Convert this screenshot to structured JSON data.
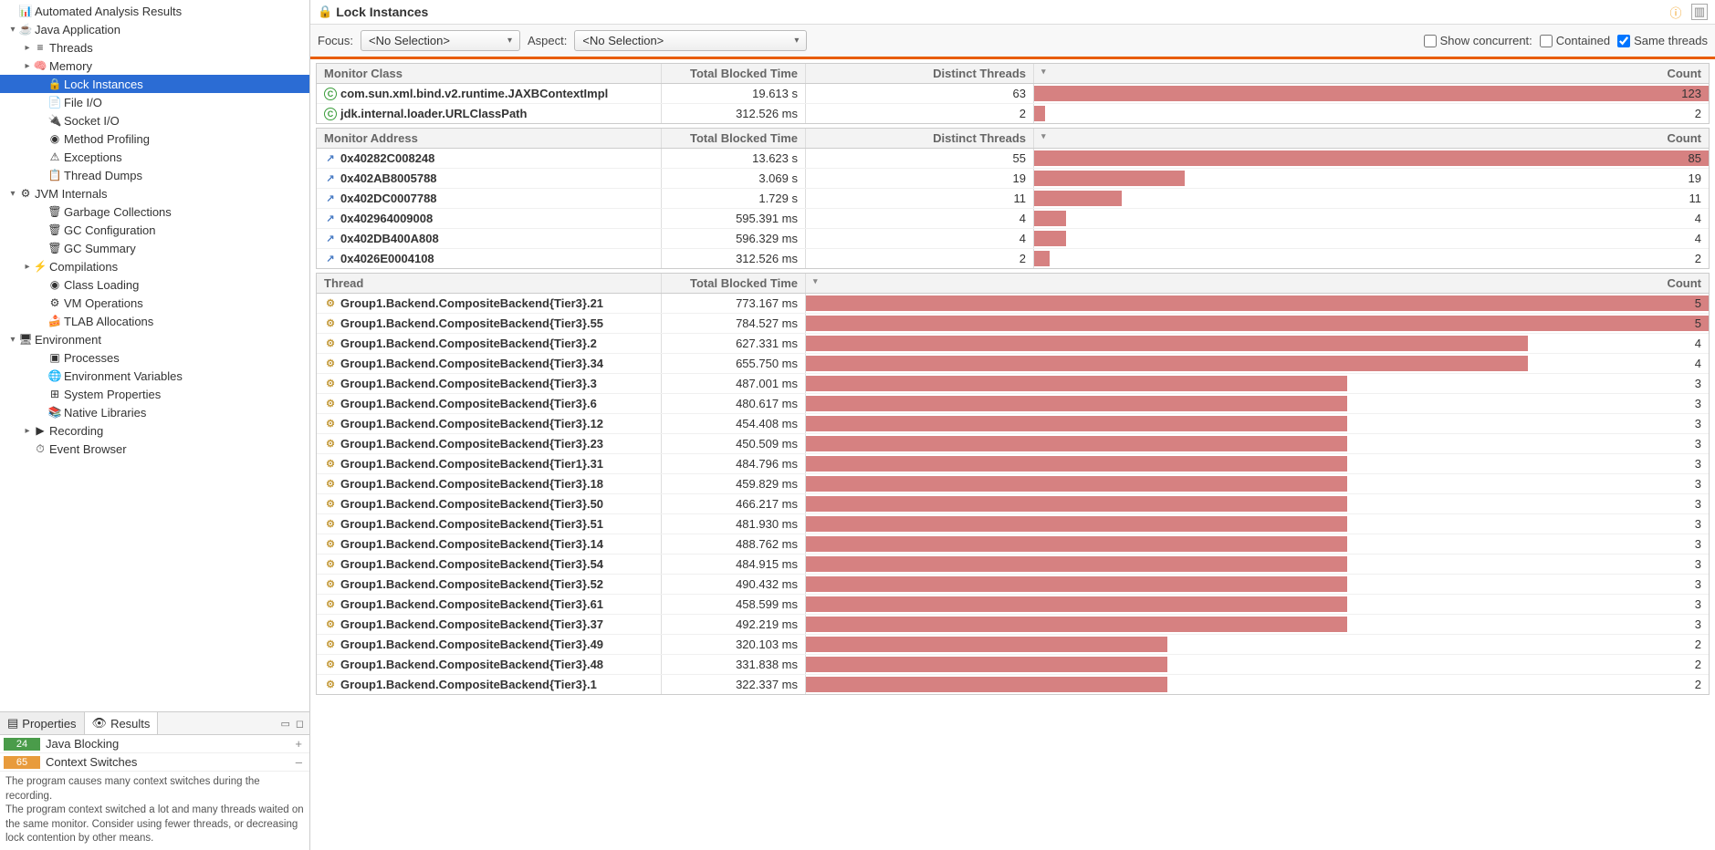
{
  "tree": [
    {
      "level": 0,
      "tw": "",
      "icon": "📊",
      "label": "Automated Analysis Results"
    },
    {
      "level": 0,
      "tw": "▾",
      "icon": "☕",
      "label": "Java Application"
    },
    {
      "level": 1,
      "tw": "▸",
      "icon": "≡",
      "label": "Threads"
    },
    {
      "level": 1,
      "tw": "▸",
      "icon": "🧠",
      "label": "Memory"
    },
    {
      "level": 2,
      "tw": "",
      "icon": "🔒",
      "label": "Lock Instances",
      "selected": true
    },
    {
      "level": 2,
      "tw": "",
      "icon": "📄",
      "label": "File I/O"
    },
    {
      "level": 2,
      "tw": "",
      "icon": "🔌",
      "label": "Socket I/O"
    },
    {
      "level": 2,
      "tw": "",
      "icon": "◉",
      "label": "Method Profiling"
    },
    {
      "level": 2,
      "tw": "",
      "icon": "⚠",
      "label": "Exceptions"
    },
    {
      "level": 2,
      "tw": "",
      "icon": "📋",
      "label": "Thread Dumps"
    },
    {
      "level": 0,
      "tw": "▾",
      "icon": "⚙",
      "label": "JVM Internals"
    },
    {
      "level": 2,
      "tw": "",
      "icon": "🗑",
      "label": "Garbage Collections"
    },
    {
      "level": 2,
      "tw": "",
      "icon": "🗑",
      "label": "GC Configuration"
    },
    {
      "level": 2,
      "tw": "",
      "icon": "🗑",
      "label": "GC Summary"
    },
    {
      "level": 1,
      "tw": "▸",
      "icon": "⚡",
      "label": "Compilations"
    },
    {
      "level": 2,
      "tw": "",
      "icon": "◉",
      "label": "Class Loading"
    },
    {
      "level": 2,
      "tw": "",
      "icon": "⚙",
      "label": "VM Operations"
    },
    {
      "level": 2,
      "tw": "",
      "icon": "🍰",
      "label": "TLAB Allocations"
    },
    {
      "level": 0,
      "tw": "▾",
      "icon": "🖥",
      "label": "Environment"
    },
    {
      "level": 2,
      "tw": "",
      "icon": "▣",
      "label": "Processes"
    },
    {
      "level": 2,
      "tw": "",
      "icon": "🌐",
      "label": "Environment Variables"
    },
    {
      "level": 2,
      "tw": "",
      "icon": "⊞",
      "label": "System Properties"
    },
    {
      "level": 2,
      "tw": "",
      "icon": "📚",
      "label": "Native Libraries"
    },
    {
      "level": 1,
      "tw": "▸",
      "icon": "▶",
      "label": "Recording"
    },
    {
      "level": 1,
      "tw": "",
      "icon": "⏱",
      "label": "Event Browser"
    }
  ],
  "tabs": {
    "properties": "Properties",
    "results": "Results"
  },
  "resultRows": [
    {
      "badge": "24",
      "cls": "green",
      "label": "Java Blocking",
      "sign": "+"
    },
    {
      "badge": "65",
      "cls": "orange",
      "label": "Context Switches",
      "sign": "–"
    }
  ],
  "resultDesc1": "The program causes many context switches during the recording.",
  "resultDesc2": "The program context switched a lot and many threads waited on the same monitor. Consider using fewer threads, or decreasing lock contention by other means.",
  "title": "Lock Instances",
  "filter": {
    "focus": "Focus:",
    "aspect": "Aspect:",
    "noSelection": "<No Selection>",
    "showConcurrent": "Show concurrent:",
    "contained": "Contained",
    "sameThreads": "Same threads"
  },
  "headers": {
    "monitorClass": "Monitor Class",
    "monitorAddress": "Monitor Address",
    "thread": "Thread",
    "totalBlocked": "Total Blocked Time",
    "distinctThreads": "Distinct Threads",
    "count": "Count"
  },
  "monitorClass": [
    {
      "name": "com.sun.xml.bind.v2.runtime.JAXBContextImpl",
      "time": "19.613 s",
      "threads": "63",
      "count": 123,
      "max": 123
    },
    {
      "name": "jdk.internal.loader.URLClassPath",
      "time": "312.526 ms",
      "threads": "2",
      "count": 2,
      "max": 123
    }
  ],
  "monitorAddress": [
    {
      "name": "0x40282C008248",
      "time": "13.623 s",
      "threads": "55",
      "count": 85,
      "max": 85
    },
    {
      "name": "0x402AB8005788",
      "time": "3.069 s",
      "threads": "19",
      "count": 19,
      "max": 85
    },
    {
      "name": "0x402DC0007788",
      "time": "1.729 s",
      "threads": "11",
      "count": 11,
      "max": 85
    },
    {
      "name": "0x402964009008",
      "time": "595.391 ms",
      "threads": "4",
      "count": 4,
      "max": 85
    },
    {
      "name": "0x402DB400A808",
      "time": "596.329 ms",
      "threads": "4",
      "count": 4,
      "max": 85
    },
    {
      "name": "0x4026E0004108",
      "time": "312.526 ms",
      "threads": "2",
      "count": 2,
      "max": 85
    }
  ],
  "threads": [
    {
      "name": "Group1.Backend.CompositeBackend{Tier3}.21",
      "time": "773.167 ms",
      "count": 5,
      "max": 5
    },
    {
      "name": "Group1.Backend.CompositeBackend{Tier3}.55",
      "time": "784.527 ms",
      "count": 5,
      "max": 5
    },
    {
      "name": "Group1.Backend.CompositeBackend{Tier3}.2",
      "time": "627.331 ms",
      "count": 4,
      "max": 5
    },
    {
      "name": "Group1.Backend.CompositeBackend{Tier3}.34",
      "time": "655.750 ms",
      "count": 4,
      "max": 5
    },
    {
      "name": "Group1.Backend.CompositeBackend{Tier3}.3",
      "time": "487.001 ms",
      "count": 3,
      "max": 5
    },
    {
      "name": "Group1.Backend.CompositeBackend{Tier3}.6",
      "time": "480.617 ms",
      "count": 3,
      "max": 5
    },
    {
      "name": "Group1.Backend.CompositeBackend{Tier3}.12",
      "time": "454.408 ms",
      "count": 3,
      "max": 5
    },
    {
      "name": "Group1.Backend.CompositeBackend{Tier3}.23",
      "time": "450.509 ms",
      "count": 3,
      "max": 5
    },
    {
      "name": "Group1.Backend.CompositeBackend{Tier1}.31",
      "time": "484.796 ms",
      "count": 3,
      "max": 5
    },
    {
      "name": "Group1.Backend.CompositeBackend{Tier3}.18",
      "time": "459.829 ms",
      "count": 3,
      "max": 5
    },
    {
      "name": "Group1.Backend.CompositeBackend{Tier3}.50",
      "time": "466.217 ms",
      "count": 3,
      "max": 5
    },
    {
      "name": "Group1.Backend.CompositeBackend{Tier3}.51",
      "time": "481.930 ms",
      "count": 3,
      "max": 5
    },
    {
      "name": "Group1.Backend.CompositeBackend{Tier3}.14",
      "time": "488.762 ms",
      "count": 3,
      "max": 5
    },
    {
      "name": "Group1.Backend.CompositeBackend{Tier3}.54",
      "time": "484.915 ms",
      "count": 3,
      "max": 5
    },
    {
      "name": "Group1.Backend.CompositeBackend{Tier3}.52",
      "time": "490.432 ms",
      "count": 3,
      "max": 5
    },
    {
      "name": "Group1.Backend.CompositeBackend{Tier3}.61",
      "time": "458.599 ms",
      "count": 3,
      "max": 5
    },
    {
      "name": "Group1.Backend.CompositeBackend{Tier3}.37",
      "time": "492.219 ms",
      "count": 3,
      "max": 5
    },
    {
      "name": "Group1.Backend.CompositeBackend{Tier3}.49",
      "time": "320.103 ms",
      "count": 2,
      "max": 5
    },
    {
      "name": "Group1.Backend.CompositeBackend{Tier3}.48",
      "time": "331.838 ms",
      "count": 2,
      "max": 5
    },
    {
      "name": "Group1.Backend.CompositeBackend{Tier3}.1",
      "time": "322.337 ms",
      "count": 2,
      "max": 5
    }
  ]
}
